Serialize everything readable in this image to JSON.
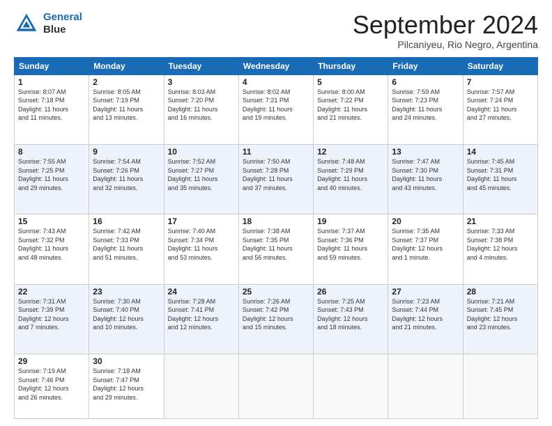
{
  "header": {
    "logo_line1": "General",
    "logo_line2": "Blue",
    "month": "September 2024",
    "location": "Pilcaniyeu, Rio Negro, Argentina"
  },
  "days_of_week": [
    "Sunday",
    "Monday",
    "Tuesday",
    "Wednesday",
    "Thursday",
    "Friday",
    "Saturday"
  ],
  "weeks": [
    [
      {
        "day": "1",
        "info": "Sunrise: 8:07 AM\nSunset: 7:18 PM\nDaylight: 11 hours\nand 11 minutes."
      },
      {
        "day": "2",
        "info": "Sunrise: 8:05 AM\nSunset: 7:19 PM\nDaylight: 11 hours\nand 13 minutes."
      },
      {
        "day": "3",
        "info": "Sunrise: 8:03 AM\nSunset: 7:20 PM\nDaylight: 11 hours\nand 16 minutes."
      },
      {
        "day": "4",
        "info": "Sunrise: 8:02 AM\nSunset: 7:21 PM\nDaylight: 11 hours\nand 19 minutes."
      },
      {
        "day": "5",
        "info": "Sunrise: 8:00 AM\nSunset: 7:22 PM\nDaylight: 11 hours\nand 21 minutes."
      },
      {
        "day": "6",
        "info": "Sunrise: 7:59 AM\nSunset: 7:23 PM\nDaylight: 11 hours\nand 24 minutes."
      },
      {
        "day": "7",
        "info": "Sunrise: 7:57 AM\nSunset: 7:24 PM\nDaylight: 11 hours\nand 27 minutes."
      }
    ],
    [
      {
        "day": "8",
        "info": "Sunrise: 7:55 AM\nSunset: 7:25 PM\nDaylight: 11 hours\nand 29 minutes."
      },
      {
        "day": "9",
        "info": "Sunrise: 7:54 AM\nSunset: 7:26 PM\nDaylight: 11 hours\nand 32 minutes."
      },
      {
        "day": "10",
        "info": "Sunrise: 7:52 AM\nSunset: 7:27 PM\nDaylight: 11 hours\nand 35 minutes."
      },
      {
        "day": "11",
        "info": "Sunrise: 7:50 AM\nSunset: 7:28 PM\nDaylight: 11 hours\nand 37 minutes."
      },
      {
        "day": "12",
        "info": "Sunrise: 7:48 AM\nSunset: 7:29 PM\nDaylight: 11 hours\nand 40 minutes."
      },
      {
        "day": "13",
        "info": "Sunrise: 7:47 AM\nSunset: 7:30 PM\nDaylight: 11 hours\nand 43 minutes."
      },
      {
        "day": "14",
        "info": "Sunrise: 7:45 AM\nSunset: 7:31 PM\nDaylight: 11 hours\nand 45 minutes."
      }
    ],
    [
      {
        "day": "15",
        "info": "Sunrise: 7:43 AM\nSunset: 7:32 PM\nDaylight: 11 hours\nand 48 minutes."
      },
      {
        "day": "16",
        "info": "Sunrise: 7:42 AM\nSunset: 7:33 PM\nDaylight: 11 hours\nand 51 minutes."
      },
      {
        "day": "17",
        "info": "Sunrise: 7:40 AM\nSunset: 7:34 PM\nDaylight: 11 hours\nand 53 minutes."
      },
      {
        "day": "18",
        "info": "Sunrise: 7:38 AM\nSunset: 7:35 PM\nDaylight: 11 hours\nand 56 minutes."
      },
      {
        "day": "19",
        "info": "Sunrise: 7:37 AM\nSunset: 7:36 PM\nDaylight: 11 hours\nand 59 minutes."
      },
      {
        "day": "20",
        "info": "Sunrise: 7:35 AM\nSunset: 7:37 PM\nDaylight: 12 hours\nand 1 minute."
      },
      {
        "day": "21",
        "info": "Sunrise: 7:33 AM\nSunset: 7:38 PM\nDaylight: 12 hours\nand 4 minutes."
      }
    ],
    [
      {
        "day": "22",
        "info": "Sunrise: 7:31 AM\nSunset: 7:39 PM\nDaylight: 12 hours\nand 7 minutes."
      },
      {
        "day": "23",
        "info": "Sunrise: 7:30 AM\nSunset: 7:40 PM\nDaylight: 12 hours\nand 10 minutes."
      },
      {
        "day": "24",
        "info": "Sunrise: 7:28 AM\nSunset: 7:41 PM\nDaylight: 12 hours\nand 12 minutes."
      },
      {
        "day": "25",
        "info": "Sunrise: 7:26 AM\nSunset: 7:42 PM\nDaylight: 12 hours\nand 15 minutes."
      },
      {
        "day": "26",
        "info": "Sunrise: 7:25 AM\nSunset: 7:43 PM\nDaylight: 12 hours\nand 18 minutes."
      },
      {
        "day": "27",
        "info": "Sunrise: 7:23 AM\nSunset: 7:44 PM\nDaylight: 12 hours\nand 21 minutes."
      },
      {
        "day": "28",
        "info": "Sunrise: 7:21 AM\nSunset: 7:45 PM\nDaylight: 12 hours\nand 23 minutes."
      }
    ],
    [
      {
        "day": "29",
        "info": "Sunrise: 7:19 AM\nSunset: 7:46 PM\nDaylight: 12 hours\nand 26 minutes."
      },
      {
        "day": "30",
        "info": "Sunrise: 7:18 AM\nSunset: 7:47 PM\nDaylight: 12 hours\nand 29 minutes."
      },
      {
        "day": "",
        "info": ""
      },
      {
        "day": "",
        "info": ""
      },
      {
        "day": "",
        "info": ""
      },
      {
        "day": "",
        "info": ""
      },
      {
        "day": "",
        "info": ""
      }
    ]
  ]
}
